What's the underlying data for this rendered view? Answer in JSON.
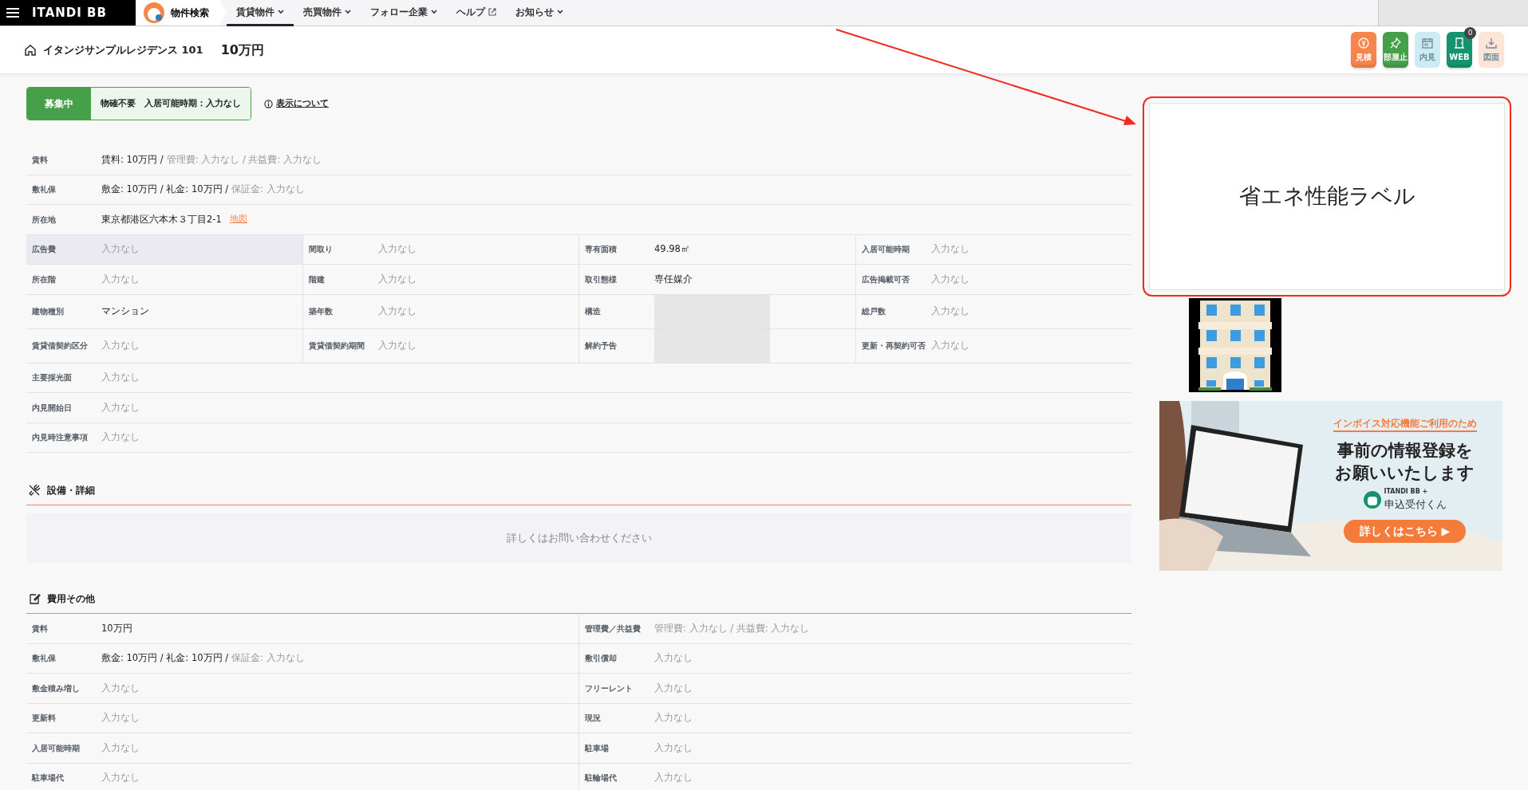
{
  "nav": {
    "brand": "ITANDI BB",
    "search_label": "物件検索",
    "tabs": [
      {
        "label": "賃貸物件",
        "selected": true,
        "kind": "dropdown"
      },
      {
        "label": "売買物件",
        "selected": false,
        "kind": "dropdown"
      },
      {
        "label": "フォロー企業",
        "selected": false,
        "kind": "dropdown"
      },
      {
        "label": "ヘルプ",
        "selected": false,
        "kind": "external"
      },
      {
        "label": "お知らせ",
        "selected": false,
        "kind": "dropdown"
      }
    ]
  },
  "header": {
    "property_name": "イタンジサンプルレジデンス 101",
    "rent": "10万円",
    "actions": [
      {
        "label": "見積",
        "color": "#f5854a",
        "disabled": false
      },
      {
        "label": "部屋止",
        "color": "#46a049",
        "disabled": false
      },
      {
        "label": "内見",
        "color": "#cdebf4",
        "disabled": true
      },
      {
        "label": "WEB",
        "color": "#13946f",
        "disabled": false,
        "badge": "0"
      },
      {
        "label": "図面",
        "color": "#fde4d8",
        "disabled": true
      }
    ]
  },
  "status": {
    "badge": "募集中",
    "notes": "物確不要　入居可能時期：入力なし",
    "help_link": "表示について"
  },
  "summary_rows": [
    {
      "label": "賃料",
      "parts": [
        {
          "text": "賃料: 10万円 /",
          "muted": false
        },
        {
          "text": "管理費: 入力なし / 共益費: 入力なし",
          "muted": true
        }
      ]
    },
    {
      "label": "敷礼保",
      "parts": [
        {
          "text": "敷金: 10万円 / 礼金: 10万円 /",
          "muted": false
        },
        {
          "text": "保証金: 入力なし",
          "muted": true
        }
      ]
    },
    {
      "label": "所在地",
      "parts": [
        {
          "text": "東京都港区六本木３丁目2-1",
          "muted": false
        }
      ],
      "link": "地図"
    }
  ],
  "grid_rows": [
    {
      "cells": [
        {
          "label": "広告費",
          "value": "入力なし",
          "muted": true,
          "highlighted": true
        },
        {
          "label": "間取り",
          "value": "入力なし",
          "muted": true,
          "highlighted": false
        },
        {
          "label": "専有面積",
          "value": "49.98㎡",
          "muted": false,
          "highlighted": false
        },
        {
          "label": "入居可能時期",
          "value": "入力なし",
          "muted": true,
          "highlighted": false
        }
      ]
    },
    {
      "cells": [
        {
          "label": "所在階",
          "value": "入力なし",
          "muted": true,
          "highlighted": false
        },
        {
          "label": "階建",
          "value": "入力なし",
          "muted": true,
          "highlighted": false
        },
        {
          "label": "取引態様",
          "value": "専任媒介",
          "muted": false,
          "highlighted": false
        },
        {
          "label": "広告掲載可否",
          "value": "入力なし",
          "muted": true,
          "highlighted": false
        }
      ]
    },
    {
      "cells": [
        {
          "label": "建物種別",
          "value": "マンション",
          "muted": false,
          "highlighted": false
        },
        {
          "label": "築年数",
          "value": "入力なし",
          "muted": true,
          "highlighted": false
        },
        {
          "label": "構造",
          "redacted": true,
          "highlighted": false
        },
        {
          "label": "総戸数",
          "value": "入力なし",
          "muted": true,
          "highlighted": false
        }
      ]
    },
    {
      "cells": [
        {
          "label": "賃貸借契約区分",
          "value": "入力なし",
          "muted": true,
          "highlighted": false
        },
        {
          "label": "賃貸借契約期間",
          "value": "入力なし",
          "muted": true,
          "highlighted": false
        },
        {
          "label": "解約予告",
          "redacted": true,
          "highlighted": false
        },
        {
          "label": "更新・再契約可否",
          "value": "入力なし",
          "muted": true,
          "highlighted": false
        }
      ]
    },
    {
      "cells": [
        {
          "label": "主要採光面",
          "value": "入力なし",
          "muted": true,
          "highlighted": false
        }
      ]
    },
    {
      "cells": [
        {
          "label": "内見開始日",
          "value": "入力なし",
          "muted": true,
          "highlighted": false
        }
      ]
    },
    {
      "cells": [
        {
          "label": "内見時注意事項",
          "value": "入力なし",
          "muted": true,
          "highlighted": false
        }
      ]
    }
  ],
  "facilities": {
    "heading": "設備・詳細",
    "note": "詳しくはお問い合わせください"
  },
  "costs": {
    "heading": "費用その他",
    "rows": [
      {
        "cells": [
          {
            "label": "賃料",
            "parts": [
              {
                "text": "10万円",
                "muted": false
              }
            ]
          },
          {
            "label": "管理費／共益費",
            "parts": [
              {
                "text": "管理費: 入力なし / 共益費: 入力なし",
                "muted": true
              }
            ]
          }
        ]
      },
      {
        "cells": [
          {
            "label": "敷礼保",
            "parts": [
              {
                "text": "敷金: 10万円 / 礼金: 10万円 /",
                "muted": false
              },
              {
                "text": "保証金: 入力なし",
                "muted": true
              }
            ]
          },
          {
            "label": "敷引償却",
            "parts": [
              {
                "text": "入力なし",
                "muted": true
              }
            ]
          }
        ]
      },
      {
        "cells": [
          {
            "label": "敷金積み増し",
            "parts": [
              {
                "text": "入力なし",
                "muted": true
              }
            ]
          },
          {
            "label": "フリーレント",
            "parts": [
              {
                "text": "入力なし",
                "muted": true
              }
            ]
          }
        ]
      },
      {
        "cells": [
          {
            "label": "更新料",
            "parts": [
              {
                "text": "入力なし",
                "muted": true
              }
            ]
          },
          {
            "label": "現況",
            "parts": [
              {
                "text": "入力なし",
                "muted": true
              }
            ]
          }
        ]
      },
      {
        "cells": [
          {
            "label": "入居可能時期",
            "parts": [
              {
                "text": "入力なし",
                "muted": true
              }
            ]
          },
          {
            "label": "駐車場",
            "parts": [
              {
                "text": "入力なし",
                "muted": true
              }
            ]
          }
        ]
      },
      {
        "cells": [
          {
            "label": "駐車場代",
            "parts": [
              {
                "text": "入力なし",
                "muted": true
              }
            ]
          },
          {
            "label": "駐輪場代",
            "parts": [
              {
                "text": "入力なし",
                "muted": true
              }
            ]
          }
        ]
      }
    ]
  },
  "side": {
    "energy_label": "省エネ性能ラベル",
    "banner": {
      "kicker": "インボイス対応機能ご利用のため",
      "headline_1": "事前の情報登録を",
      "headline_2": "お願いいたします",
      "product_brand": "ITANDI BB +",
      "product_name": "申込受付くん",
      "cta": "詳しくはこちら ▶"
    }
  }
}
